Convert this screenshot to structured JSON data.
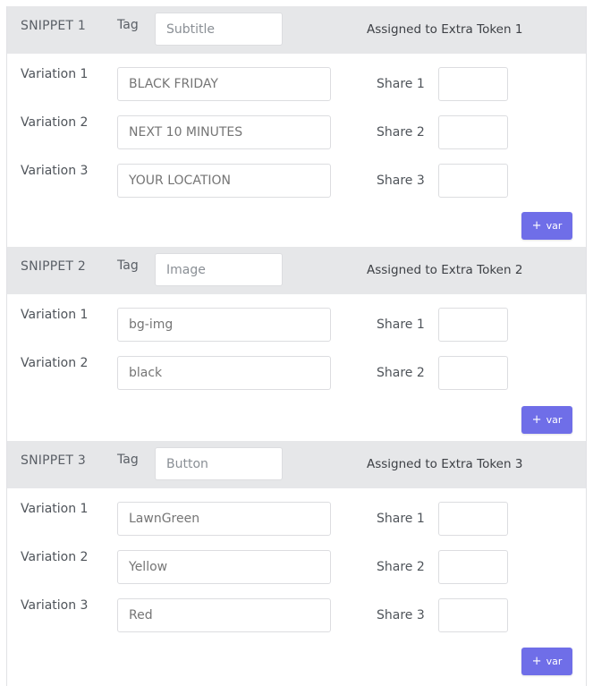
{
  "tag_label": "Tag",
  "var_button_plus": "+",
  "var_button_label": "var",
  "snippets": [
    {
      "title": "SNIPPET 1",
      "tag_placeholder": "Subtitle",
      "assigned": "Assigned to Extra Token 1",
      "variations": [
        {
          "label": "Variation 1",
          "placeholder": "BLACK FRIDAY",
          "share_label": "Share 1"
        },
        {
          "label": "Variation 2",
          "placeholder": "NEXT 10 MINUTES",
          "share_label": "Share 2"
        },
        {
          "label": "Variation 3",
          "placeholder": "YOUR LOCATION",
          "share_label": "Share 3"
        }
      ]
    },
    {
      "title": "SNIPPET 2",
      "tag_placeholder": "Image",
      "assigned": "Assigned to Extra Token 2",
      "variations": [
        {
          "label": "Variation 1",
          "placeholder": "bg-img",
          "share_label": "Share 1"
        },
        {
          "label": "Variation 2",
          "placeholder": "black",
          "share_label": "Share 2"
        }
      ]
    },
    {
      "title": "SNIPPET 3",
      "tag_placeholder": "Button",
      "assigned": "Assigned to Extra Token 3",
      "variations": [
        {
          "label": "Variation 1",
          "placeholder": "LawnGreen",
          "share_label": "Share 1"
        },
        {
          "label": "Variation 2",
          "placeholder": "Yellow",
          "share_label": "Share 2"
        },
        {
          "label": "Variation 3",
          "placeholder": "Red",
          "share_label": "Share 3"
        }
      ]
    }
  ]
}
